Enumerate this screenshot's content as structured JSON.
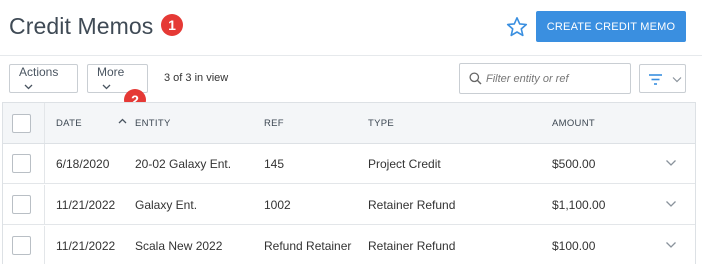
{
  "header": {
    "title": "Credit Memos",
    "create_button_label": "CREATE CREDIT MEMO"
  },
  "annotations": [
    "1",
    "2"
  ],
  "toolbar": {
    "actions_label": "Actions",
    "more_label": "More",
    "view_count": "3 of 3 in view",
    "filter_placeholder": "Filter entity or ref"
  },
  "table": {
    "columns": [
      "DATE",
      "ENTITY",
      "REF",
      "TYPE",
      "AMOUNT"
    ],
    "rows": [
      {
        "date": "6/18/2020",
        "entity": "20-02 Galaxy Ent.",
        "ref": "145",
        "type": "Project Credit",
        "amount": "$500.00"
      },
      {
        "date": "11/21/2022",
        "entity": "Galaxy Ent.",
        "ref": "1002",
        "type": "Retainer Refund",
        "amount": "$1,100.00"
      },
      {
        "date": "11/21/2022",
        "entity": "Scala New 2022",
        "ref": "Refund Retainer",
        "type": "Retainer Refund",
        "amount": "$100.00"
      }
    ]
  },
  "icons": {
    "favorite": "star-outline-icon",
    "search": "search-icon",
    "filter": "filter-lines-icon",
    "sort": "sort-ascending-icon",
    "expand": "chevron-down-icon"
  },
  "colors": {
    "accent": "#3a8fe0",
    "badge": "#e53935",
    "header_bg": "#f4f6f8"
  }
}
